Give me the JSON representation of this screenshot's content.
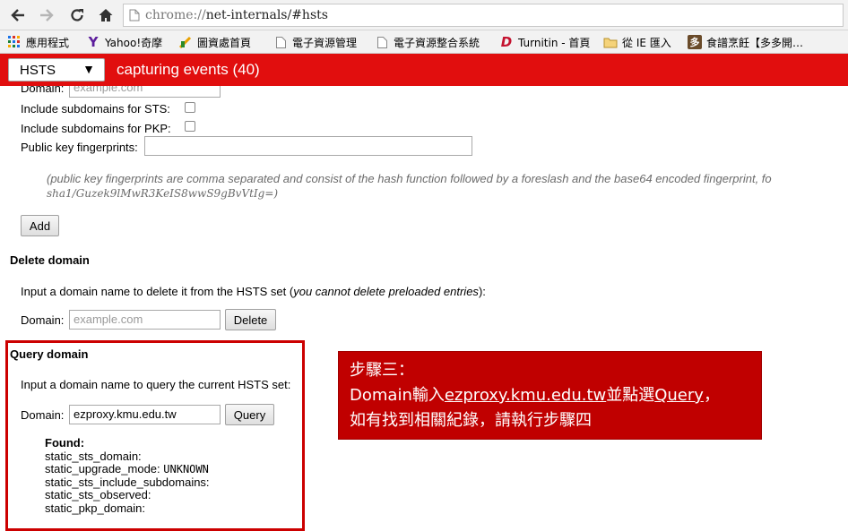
{
  "browser": {
    "url_scheme": "chrome://",
    "url_rest": "net-internals/#hsts",
    "bookmarks": [
      {
        "label": "應用程式",
        "icon": "apps-grid-icon"
      },
      {
        "label": "Yahoo!奇摩",
        "icon": "yahoo-icon"
      },
      {
        "label": "圖資處首頁",
        "icon": "library-icon"
      },
      {
        "label": "電子資源管理",
        "icon": "page-icon"
      },
      {
        "label": "電子資源整合系統",
        "icon": "page-icon"
      },
      {
        "label": "Turnitin - 首頁",
        "icon": "turnitin-icon"
      },
      {
        "label": "從 IE 匯入",
        "icon": "folder-icon"
      },
      {
        "label": "食譜烹飪【多多開…",
        "icon": "recipe-icon"
      }
    ]
  },
  "header": {
    "view_selected": "HSTS",
    "status": "capturing events (40)"
  },
  "add_domain": {
    "domain_label": "Domain:",
    "domain_placeholder": "example.com",
    "include_sts_label": "Include subdomains for STS:",
    "include_pkp_label": "Include subdomains for PKP:",
    "fingerprints_label": "Public key fingerprints:",
    "fingerprints_value": "",
    "note_line1": "(public key fingerprints are comma separated and consist of the hash function followed by a foreslash and the base64 encoded fingerprint, fo",
    "note_line2": "sha1/Guzek9lMwR3KeIS8wwS9gBvVtIg=)",
    "add_button": "Add"
  },
  "delete_domain": {
    "heading": "Delete domain",
    "desc_prefix": "Input a domain name to delete it from the HSTS set (",
    "desc_italic": "you cannot delete preloaded entries",
    "desc_suffix": "):",
    "domain_label": "Domain:",
    "domain_placeholder": "example.com",
    "delete_button": "Delete"
  },
  "query_domain": {
    "heading": "Query domain",
    "desc": "Input a domain name to query the current HSTS set:",
    "domain_label": "Domain:",
    "domain_value": "ezproxy.kmu.edu.tw",
    "query_button": "Query",
    "found_label": "Found:",
    "results": [
      {
        "key": "static_sts_domain:",
        "value": ""
      },
      {
        "key": "static_upgrade_mode:",
        "value": "UNKNOWN"
      },
      {
        "key": "static_sts_include_subdomains:",
        "value": ""
      },
      {
        "key": "static_sts_observed:",
        "value": ""
      },
      {
        "key": "static_pkp_domain:",
        "value": ""
      }
    ]
  },
  "callout": {
    "line1": "步驟三：",
    "line2_prefix": "Domain輸入",
    "line2_link1": "ezproxy.kmu.edu.tw",
    "line2_mid": "並點選",
    "line2_link2": "Query",
    "line2_suffix": "，",
    "line3": "如有找到相關紀錄，請執行步驟四"
  },
  "colors": {
    "header_red": "#e10e0e",
    "callout_red": "#c00000",
    "highlight_border": "#cc0000"
  }
}
